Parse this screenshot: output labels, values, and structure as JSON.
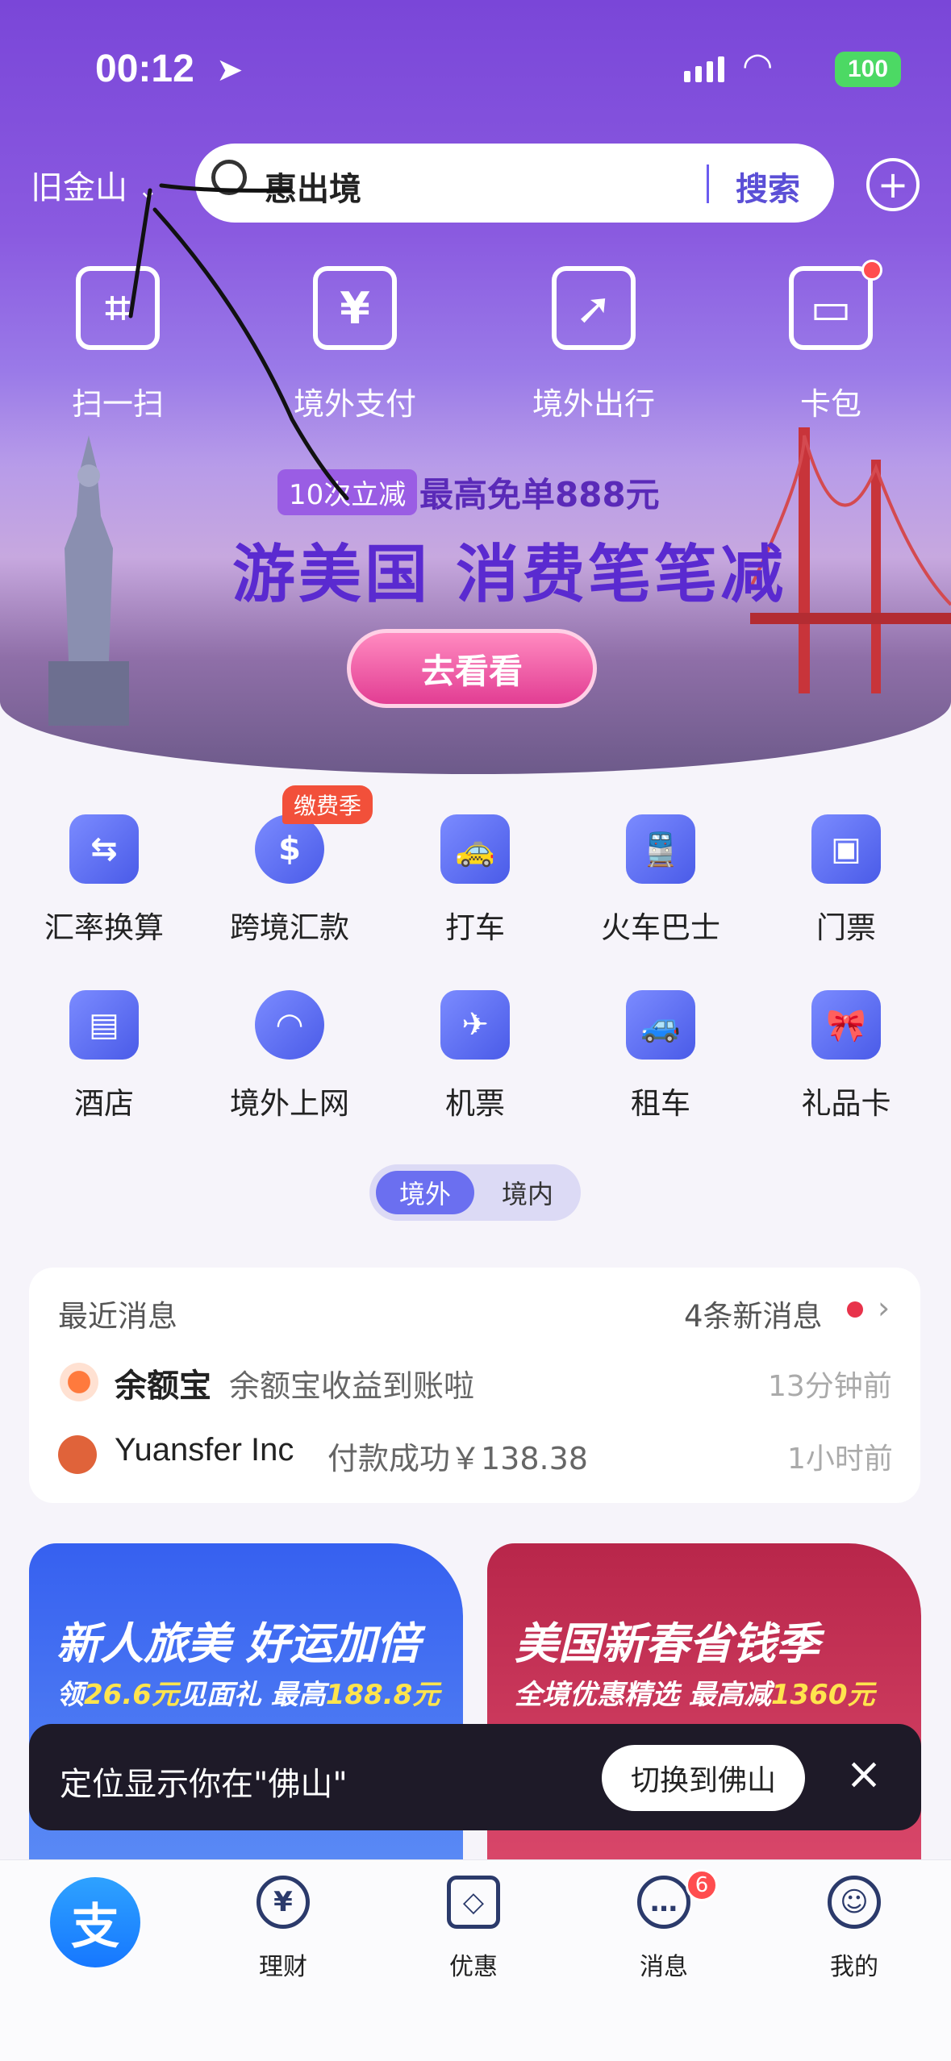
{
  "status_bar": {
    "time": "00:12",
    "battery": "100"
  },
  "header": {
    "city": "旧金山",
    "search_text": "惠出境",
    "search_button": "搜索"
  },
  "quick_actions": [
    {
      "label": "扫一扫",
      "icon": "scan-icon"
    },
    {
      "label": "境外支付",
      "icon": "yen-payment-icon"
    },
    {
      "label": "境外出行",
      "icon": "travel-arrow-icon"
    },
    {
      "label": "卡包",
      "icon": "wallet-icon"
    }
  ],
  "promo": {
    "tag": "10次立减",
    "subtitle": "最高免单888元",
    "title": "游美国 消费笔笔减",
    "cta": "去看看"
  },
  "services": [
    {
      "label": "汇率换算",
      "icon": "exchange-rate-icon"
    },
    {
      "label": "跨境汇款",
      "icon": "remittance-icon",
      "tag": "缴费季"
    },
    {
      "label": "打车",
      "icon": "taxi-icon"
    },
    {
      "label": "火车巴士",
      "icon": "train-icon"
    },
    {
      "label": "门票",
      "icon": "ticket-icon"
    },
    {
      "label": "酒店",
      "icon": "hotel-icon"
    },
    {
      "label": "境外上网",
      "icon": "wifi-icon"
    },
    {
      "label": "机票",
      "icon": "plane-icon"
    },
    {
      "label": "租车",
      "icon": "car-rental-icon"
    },
    {
      "label": "礼品卡",
      "icon": "gift-card-icon"
    }
  ],
  "region_toggle": {
    "active": "境外",
    "inactive": "境内"
  },
  "messages": {
    "title": "最近消息",
    "count": "4条新消息",
    "items": [
      {
        "name": "余额宝",
        "text": "余额宝收益到账啦",
        "time": "13分钟前"
      },
      {
        "name": "Yuansfer Inc",
        "text": "付款成功￥138.38",
        "time": "1小时前"
      }
    ]
  },
  "banners": [
    {
      "title": "新人旅美 好运加倍",
      "sub_a": "领",
      "sub_b": "26.6元",
      "sub_c": "见面礼 最高",
      "sub_d": "188.8元"
    },
    {
      "title": "美国新春省钱季",
      "sub_a": "全境优惠精选 最高减",
      "sub_b": "1360元"
    }
  ],
  "toast": {
    "text": "定位显示你在\"佛山\"",
    "button": "切换到佛山"
  },
  "tabbar": {
    "home_glyph": "支",
    "items": [
      {
        "label": "理财",
        "glyph": "¥"
      },
      {
        "label": "优惠",
        "glyph": "◇"
      },
      {
        "label": "消息",
        "glyph": "…",
        "badge": "6"
      },
      {
        "label": "我的",
        "glyph": "☺"
      }
    ]
  },
  "colors": {
    "brand_purple": "#7a46d8",
    "accent_blue": "#1677ff",
    "alert_red": "#ff4d4f"
  }
}
